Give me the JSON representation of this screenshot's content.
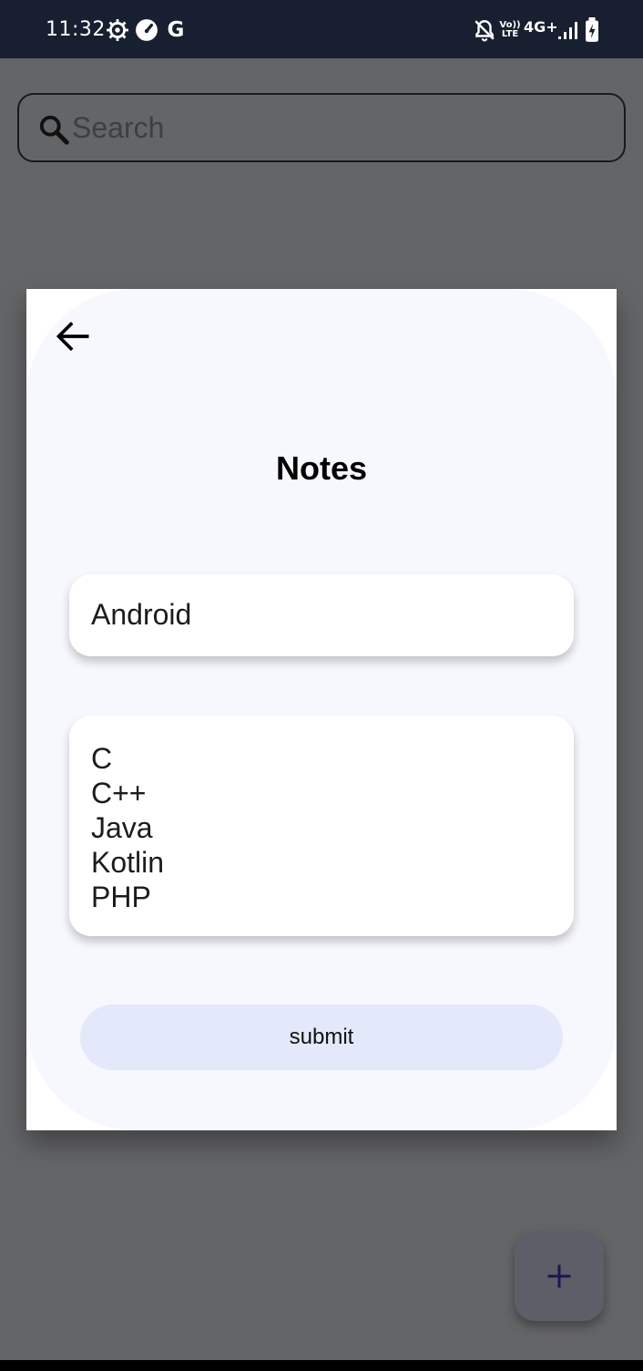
{
  "status_bar": {
    "time": "11:32",
    "left_icons": [
      "settings-icon",
      "speedometer-icon",
      "google-icon"
    ],
    "google_letter": "G",
    "right_icons": [
      "notifications-off-icon",
      "volte-icon",
      "signal-icon",
      "battery-charging-icon"
    ],
    "network": "4G+",
    "volte_top": "Vo))",
    "volte_bottom": "LTE"
  },
  "search": {
    "placeholder": "Search",
    "value": ""
  },
  "dialog": {
    "title": "Notes",
    "note_title": "Android",
    "note_body_lines": [
      "C",
      "C++",
      "Java",
      "Kotlin",
      "PHP"
    ],
    "submit_label": "submit"
  },
  "fab": {
    "icon": "plus-icon"
  },
  "colors": {
    "status_bar": "#181f30",
    "scrim_background": "#646567",
    "dialog_surface": "#f7f8fe",
    "button": "#e3e8fa",
    "fab": "#5d5f68",
    "fab_icon": "#1d1550"
  }
}
